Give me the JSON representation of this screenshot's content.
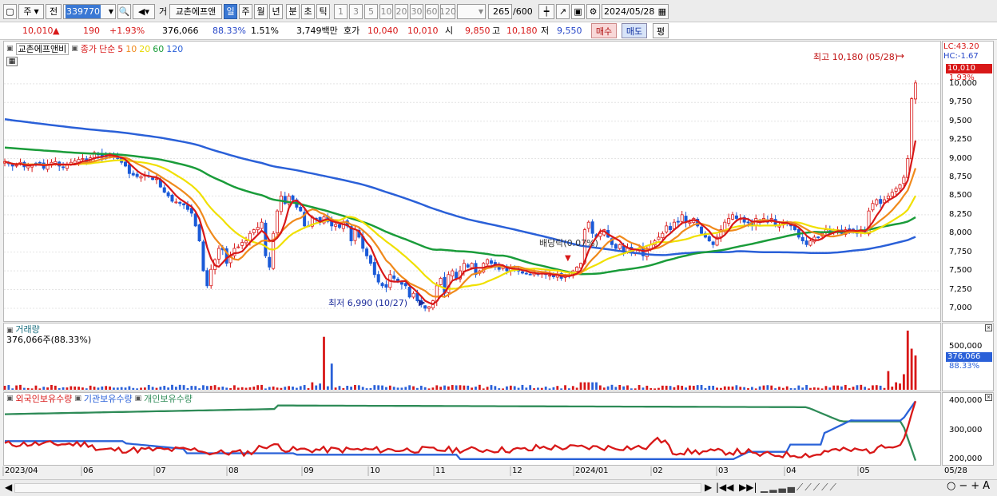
{
  "toolbar": {
    "stock_type": "주",
    "prev": "전",
    "code": "339770",
    "exchange": "거",
    "stock_name": "교촌에프앤",
    "periods": [
      "일",
      "주",
      "월",
      "년",
      "분",
      "초",
      "틱"
    ],
    "selected_period": "일",
    "minute_options": [
      "1",
      "3",
      "5",
      "10",
      "20",
      "30",
      "60",
      "120"
    ],
    "count_display": "265",
    "count_total": "/600",
    "date": "2024/05/28"
  },
  "info": {
    "price": "10,010",
    "arrow": "▲",
    "change": "190",
    "change_pct": "+1.93%",
    "volume": "376,066",
    "vol_ratio": "88.33%",
    "turnover": "1.51%",
    "amount": "3,749백만",
    "ask_label": "호가",
    "ask1": "10,040",
    "ask2": "10,010",
    "open_label": "시",
    "open": "9,850",
    "high_label": "고",
    "high": "10,180",
    "low_label": "저",
    "low": "9,550",
    "buy": "매수",
    "sell": "매도",
    "eval": "평"
  },
  "legend": {
    "name": "교촌에프앤비",
    "price_label": "종가",
    "ma_label": "단순",
    "ma": [
      {
        "p": "5",
        "color": "#d81818"
      },
      {
        "p": "10",
        "color": "#f08a1c"
      },
      {
        "p": "20",
        "color": "#e6d800"
      },
      {
        "p": "60",
        "color": "#1a9c3a"
      },
      {
        "p": "120",
        "color": "#2a60d8"
      }
    ]
  },
  "right_panel": {
    "lc": "LC:43.20",
    "hc": "HC:-1.67",
    "price_tag": "10,010",
    "pct_tag": "1.93%",
    "vol_tag": "376,066",
    "vol_pct": "88.33%"
  },
  "annotations": {
    "high": "최고 10,180 (05/28)",
    "low": "최저 6,990 (10/27)",
    "dividend": "배당락(0.07%)"
  },
  "volume": {
    "title": "거래량",
    "value": "376,066주(88.33%)"
  },
  "holdings": {
    "foreign": "외국인보유수량",
    "inst": "기관보유수량",
    "indiv": "개인보유수량"
  },
  "price_axis": {
    "min": 6850,
    "max": 10500,
    "ticks": [
      10000,
      9750,
      9500,
      9250,
      9000,
      8750,
      8500,
      8250,
      8000,
      7750,
      7500,
      7250,
      7000
    ],
    "labels": [
      "10,000",
      "9,750",
      "9,500",
      "9,250",
      "9,000",
      "8,750",
      "8,500",
      "8,250",
      "8,000",
      "7,750",
      "7,500",
      "7,250",
      "7,000"
    ]
  },
  "volume_axis": {
    "ticks": [
      500000
    ],
    "labels": [
      "500,000"
    ]
  },
  "holdings_axis": {
    "ticks": [
      400000,
      300000,
      200000
    ],
    "labels": [
      "400,000",
      "300,000",
      "200,000"
    ]
  },
  "x_axis": [
    "2023/04",
    "06",
    "07",
    "08",
    "09",
    "10",
    "11",
    "12",
    "2024/01",
    "02",
    "03",
    "04",
    "05",
    "05/28"
  ],
  "chart_data": [
    {
      "type": "candlestick",
      "title": "교촌에프앤비",
      "x": [
        "2023/04",
        "06",
        "07",
        "08",
        "09",
        "10",
        "11",
        "12",
        "2024/01",
        "02",
        "03",
        "04",
        "05",
        "05/28"
      ],
      "ylim": [
        6850,
        10500
      ],
      "close": [
        8960,
        8930,
        8900,
        8910,
        8950,
        8890,
        8900,
        8920,
        8930,
        8940,
        8870,
        8920,
        8950,
        8960,
        8900,
        8880,
        8910,
        8950,
        8970,
        8990,
        9000,
        8950,
        9010,
        9080,
        9050,
        9020,
        9030,
        9070,
        9020,
        9000,
        8950,
        8900,
        8800,
        8780,
        8760,
        8760,
        8780,
        8760,
        8720,
        8730,
        8620,
        8550,
        8500,
        8430,
        8420,
        8400,
        8380,
        8320,
        8270,
        8100,
        7900,
        7500,
        7300,
        7520,
        7650,
        7800,
        7780,
        7600,
        7700,
        7800,
        7820,
        7880,
        7900,
        8000,
        8050,
        8080,
        8150,
        7700,
        7550,
        8000,
        8300,
        8500,
        8400,
        8500,
        8450,
        8350,
        8300,
        8100,
        8100,
        8220,
        8200,
        8150,
        8220,
        8160,
        8100,
        8120,
        8080,
        8150,
        8100,
        7900,
        8050,
        7950,
        7800,
        7700,
        7600,
        7450,
        7350,
        7300,
        7280,
        7450,
        7400,
        7350,
        7320,
        7300,
        7150,
        7200,
        7100,
        7050,
        7000,
        7020,
        7100,
        7300,
        7400,
        7200,
        7450,
        7500,
        7400,
        7500,
        7600,
        7550,
        7600,
        7450,
        7500,
        7600,
        7650,
        7600,
        7550,
        7520,
        7550,
        7500,
        7550,
        7520,
        7500,
        7470,
        7460,
        7450,
        7480,
        7460,
        7470,
        7450,
        7440,
        7420,
        7450,
        7400,
        7440,
        7430,
        7500,
        7550,
        7600,
        8050,
        8150,
        8000,
        7950,
        8000,
        8050,
        7950,
        7850,
        7800,
        7850,
        7750,
        7800,
        7750,
        7780,
        7800,
        7700,
        7800,
        7850,
        7900,
        7950,
        8000,
        8100,
        8050,
        8150,
        8150,
        8250,
        8150,
        8150,
        8200,
        8100,
        8000,
        7950,
        7900,
        7850,
        7950,
        8050,
        8150,
        8200,
        8250,
        8200,
        8200,
        8150,
        8150,
        8100,
        8200,
        8150,
        8200,
        8150,
        8200,
        8100,
        8100,
        8150,
        8150,
        8100,
        8050,
        7950,
        7900,
        7850,
        7900,
        7950,
        7950,
        8000,
        8050,
        8000,
        8050,
        8050,
        8000,
        8050,
        8050,
        8050,
        8000,
        8050,
        8000,
        8300,
        8400,
        8450,
        8400,
        8450,
        8500,
        8550,
        8600,
        8650,
        8750,
        9000,
        9800,
        10010
      ]
    },
    {
      "type": "bar",
      "title": "거래량",
      "value": 376066
    },
    {
      "type": "line",
      "title": "보유수량",
      "ylim": [
        180000,
        420000
      ],
      "series": [
        {
          "name": "외국인보유수량",
          "color": "#2a62d8",
          "start": 262000,
          "end": 400000
        },
        {
          "name": "기관보유수량",
          "color": "#d81818",
          "start": 255000,
          "end": 400000
        },
        {
          "name": "개인보유수량",
          "color": "#2e8b57",
          "start": 355000,
          "end": 195000
        }
      ]
    }
  ]
}
